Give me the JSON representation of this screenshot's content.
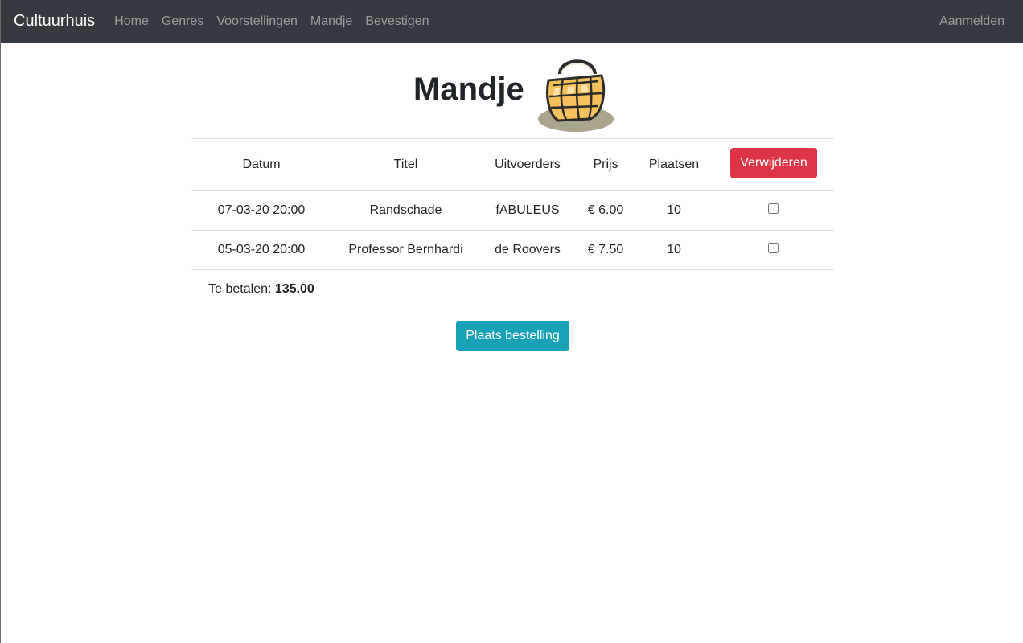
{
  "nav": {
    "brand": "Cultuurhuis",
    "links": [
      "Home",
      "Genres",
      "Voorstellingen",
      "Mandje",
      "Bevestigen"
    ],
    "login": "Aanmelden"
  },
  "page": {
    "title": "Mandje",
    "basket_icon": "basket-icon"
  },
  "table": {
    "headers": {
      "datum": "Datum",
      "titel": "Titel",
      "uitvoerders": "Uitvoerders",
      "prijs": "Prijs",
      "plaatsen": "Plaatsen",
      "remove_button": "Verwijderen"
    },
    "rows": [
      {
        "datum": "07-03-20 20:00",
        "titel": "Randschade",
        "uitvoerders": "fABULEUS",
        "prijs": "€ 6.00",
        "plaatsen": "10",
        "checked": false
      },
      {
        "datum": "05-03-20 20:00",
        "titel": "Professor Bernhardi",
        "uitvoerders": "de Roovers",
        "prijs": "€ 7.50",
        "plaatsen": "10",
        "checked": false
      }
    ],
    "total_label": "Te betalen: ",
    "total_value": "135.00"
  },
  "order_button": "Plaats bestelling",
  "colors": {
    "navbar": "#343a40",
    "danger": "#dc3545",
    "info": "#17a2b8"
  }
}
